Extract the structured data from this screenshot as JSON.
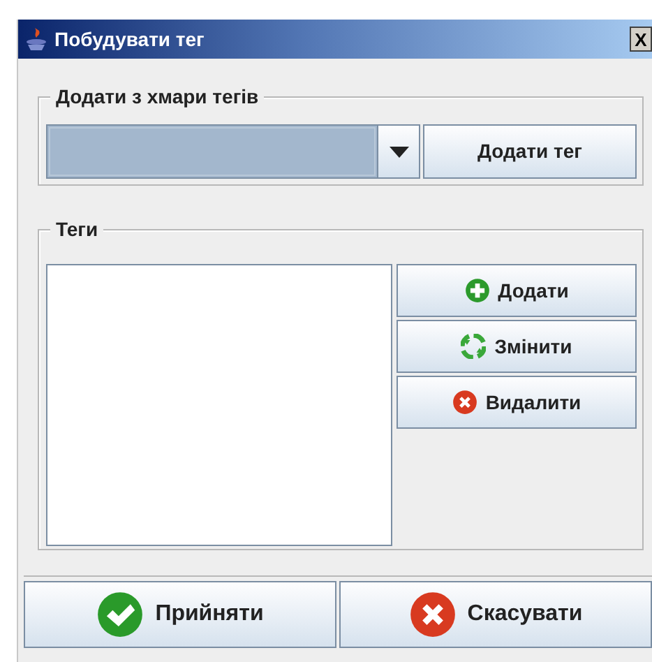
{
  "window": {
    "title": "Побудувати тег",
    "close": "X"
  },
  "cloud_group": {
    "title": "Додати з хмари тегів",
    "button": "Додати тег"
  },
  "tags_group": {
    "title": "Теги",
    "buttons": [
      {
        "label": "Додати",
        "kind": "add"
      },
      {
        "label": "Змінити",
        "kind": "edit"
      },
      {
        "label": "Видалити",
        "kind": "delete"
      }
    ]
  },
  "footer_buttons": [
    {
      "label": "Прийняти",
      "kind": "accept"
    },
    {
      "label": "Скасувати",
      "kind": "cancel"
    }
  ]
}
